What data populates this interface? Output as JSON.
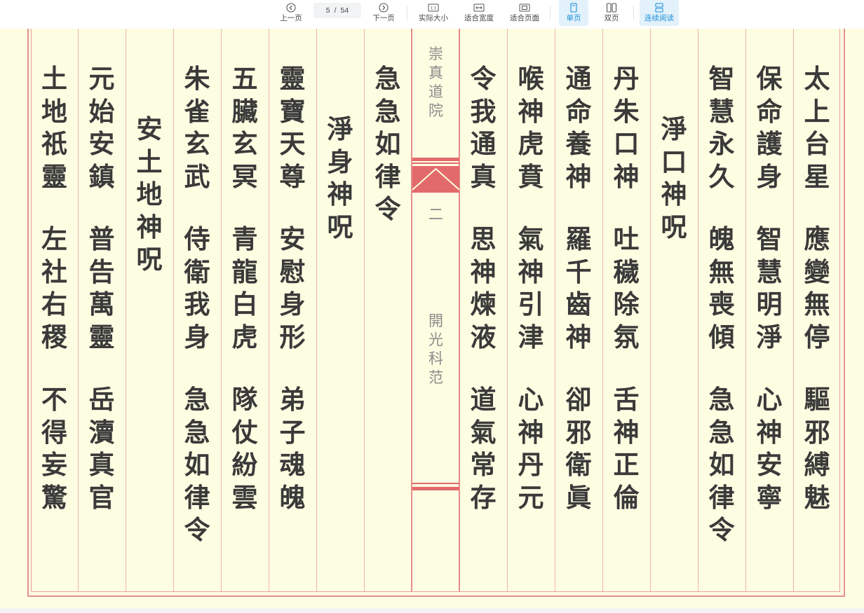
{
  "toolbar": {
    "prev_label": "上一页",
    "next_label": "下一页",
    "current_page": "5",
    "page_separator": "/",
    "total_pages": "54",
    "actual_size_label": "实际大小",
    "fit_width_label": "适合宽度",
    "fit_page_label": "适合页面",
    "single_label": "单页",
    "double_label": "双页",
    "continuous_label": "连续阅读",
    "active_color": "#1a8fd8"
  },
  "document": {
    "spine": {
      "publisher": "崇真道院",
      "page_number": "二",
      "book_title": "開光科范"
    },
    "columns": [
      [
        "太上台星",
        "應變無停",
        "驅邪縛魅"
      ],
      [
        "保命護身",
        "智慧明淨",
        "心神安寧"
      ],
      [
        "智慧永久",
        "魄無喪傾",
        "急急如律令"
      ],
      [
        "淨口神呪"
      ],
      [
        "丹朱口神",
        "吐穢除氛",
        "舌神正倫"
      ],
      [
        "通命養神",
        "羅千齒神",
        "卻邪衛眞"
      ],
      [
        "喉神虎賁",
        "氣神引津",
        "心神丹元"
      ],
      [
        "令我通真",
        "思神煉液",
        "道氣常存"
      ],
      [
        "急急如律令"
      ],
      [
        "淨身神呪"
      ],
      [
        "靈寶天尊",
        "安慰身形",
        "弟子魂魄"
      ],
      [
        "五臟玄冥",
        "青龍白虎",
        "隊仗紛雲"
      ],
      [
        "朱雀玄武",
        "侍衛我身",
        "急急如律令"
      ],
      [
        "安土地神呪"
      ],
      [
        "元始安鎮",
        "普告萬靈",
        "岳瀆真官"
      ],
      [
        "土地祇靈",
        "左社右稷",
        "不得妄驚"
      ]
    ],
    "colors": {
      "paper": "#fdfde2",
      "frame": "#e79090",
      "spine_band": "#e36a6a",
      "text": "#3a3a3a"
    }
  }
}
